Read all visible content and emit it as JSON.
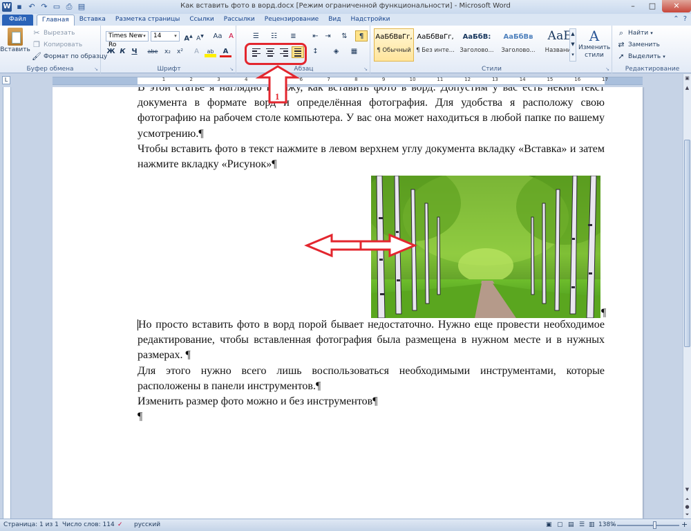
{
  "titlebar": {
    "title": "Как вставить фото в ворд.docx [Режим ограниченной функциональности]  -  Microsoft Word",
    "app_icon": "W",
    "qat_icons": [
      "save-icon",
      "undo-icon",
      "redo-icon",
      "new-doc-icon",
      "print-preview-icon",
      "open-icon"
    ],
    "buttons": {
      "minimize": "–",
      "maximize": "□",
      "close": "✕"
    }
  },
  "tabs": [
    "Файл",
    "Главная",
    "Вставка",
    "Разметка страницы",
    "Ссылки",
    "Рассылки",
    "Рецензирование",
    "Вид",
    "Надстройки"
  ],
  "ribbon": {
    "clipboard": {
      "label": "Буфер обмена",
      "paste": "Вставить",
      "cut": "Вырезать",
      "copy": "Копировать",
      "format_painter": "Формат по образцу"
    },
    "font": {
      "label": "Шрифт",
      "font_name": "Times New Ro",
      "font_size": "14",
      "grow": "A",
      "shrink": "A",
      "case": "Aa",
      "clear": "A",
      "bold": "Ж",
      "italic": "К",
      "underline": "Ч",
      "strike": "abe",
      "subscript": "x₂",
      "superscript": "x²",
      "effects": "A",
      "highlight": "ab",
      "color": "A"
    },
    "paragraph": {
      "label": "Абзац",
      "show_marks": "¶"
    },
    "styles": {
      "label": "Стили",
      "items": [
        {
          "sample": "АаБбВвГг,",
          "name": "¶ Обычный"
        },
        {
          "sample": "АаБбВвГг,",
          "name": "¶ Без инте..."
        },
        {
          "sample": "АаБбВ:",
          "name": "Заголово..."
        },
        {
          "sample": "АаБбВв",
          "name": "Заголово..."
        },
        {
          "sample": "АаБ",
          "name": "Название"
        }
      ],
      "change": "Изменить стили"
    },
    "editing": {
      "label": "Редактирование",
      "find": "Найти",
      "replace": "Заменить",
      "select": "Выделить"
    }
  },
  "ruler": {
    "numbers": [
      "1",
      "2",
      "3",
      "4",
      "5",
      "6",
      "7",
      "8",
      "9",
      "10",
      "11",
      "12",
      "13",
      "14",
      "15",
      "16",
      "17"
    ]
  },
  "document": {
    "paragraphs_top": [
      "В этой статье я наглядно покажу, как вставить фото в ворд. Допустим у вас есть некий текст документа в формате ворд и определённая фотография. Для удобства я расположу свою фотографию на рабочем столе компьютера. У вас она может находиться в любой папке по вашему усмотрению.¶",
      "Чтобы вставить фото в текст нажмите в левом верхнем углу документа вкладку «Вставка» и затем нажмите вкладку «Рисунок»¶"
    ],
    "image_pilcrow": "¶",
    "paragraphs_bottom": [
      "Но просто вставить фото в ворд порой бывает недостаточно. Нужно еще провести необходимое редактирование, чтобы вставленная фотография была размещена в нужном месте и в нужных размерах. ¶",
      "Для этого нужно всего лишь воспользоваться необходимыми инструментами, которые расположены в панели инструментов.¶",
      "Изменить размер фото можно и без инструментов¶",
      "¶"
    ],
    "annotation_number": "1"
  },
  "statusbar": {
    "page": "Страница: 1 из 1",
    "words": "Число слов: 114",
    "language": "русский",
    "zoom": "138%",
    "zoom_minus": "–",
    "zoom_plus": "+"
  },
  "colors": {
    "annotation": "#e3262e",
    "ribbon_tab_file": "#2a63b8"
  }
}
